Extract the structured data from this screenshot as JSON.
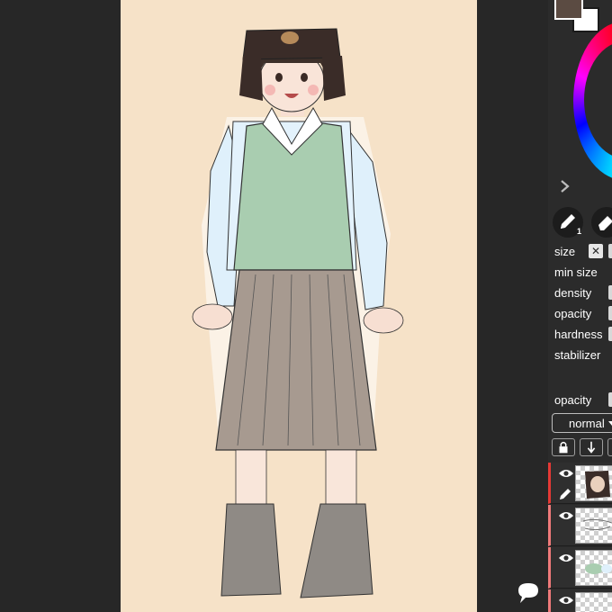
{
  "app": {
    "icons": {
      "chat": "speech-bubble-icon",
      "expand": "chevron-right-icon",
      "pencil": "pencil-icon",
      "eraser": "eraser-icon",
      "lock": "lock-icon",
      "merge": "arrow-down-icon",
      "visibility": "eye-icon"
    }
  },
  "colors": {
    "canvas_bg": "#f6e2c8",
    "foreground": "#5b4b42",
    "background": "#ffffff",
    "active_layer_marker": "#e53935"
  },
  "brush": {
    "tool_badge": "1",
    "size_reset": "✕",
    "params": [
      {
        "label": "size"
      },
      {
        "label": "min size"
      },
      {
        "label": "density"
      },
      {
        "label": "opacity"
      },
      {
        "label": "hardness"
      },
      {
        "label": "stabilizer"
      }
    ]
  },
  "layers": {
    "opacity_label": "opacity",
    "blend_mode": "normal",
    "items": [
      {
        "kind": "hat",
        "active": true
      },
      {
        "kind": "sketch",
        "active": false
      },
      {
        "kind": "color",
        "active": false
      },
      {
        "kind": "base",
        "active": false
      }
    ]
  }
}
